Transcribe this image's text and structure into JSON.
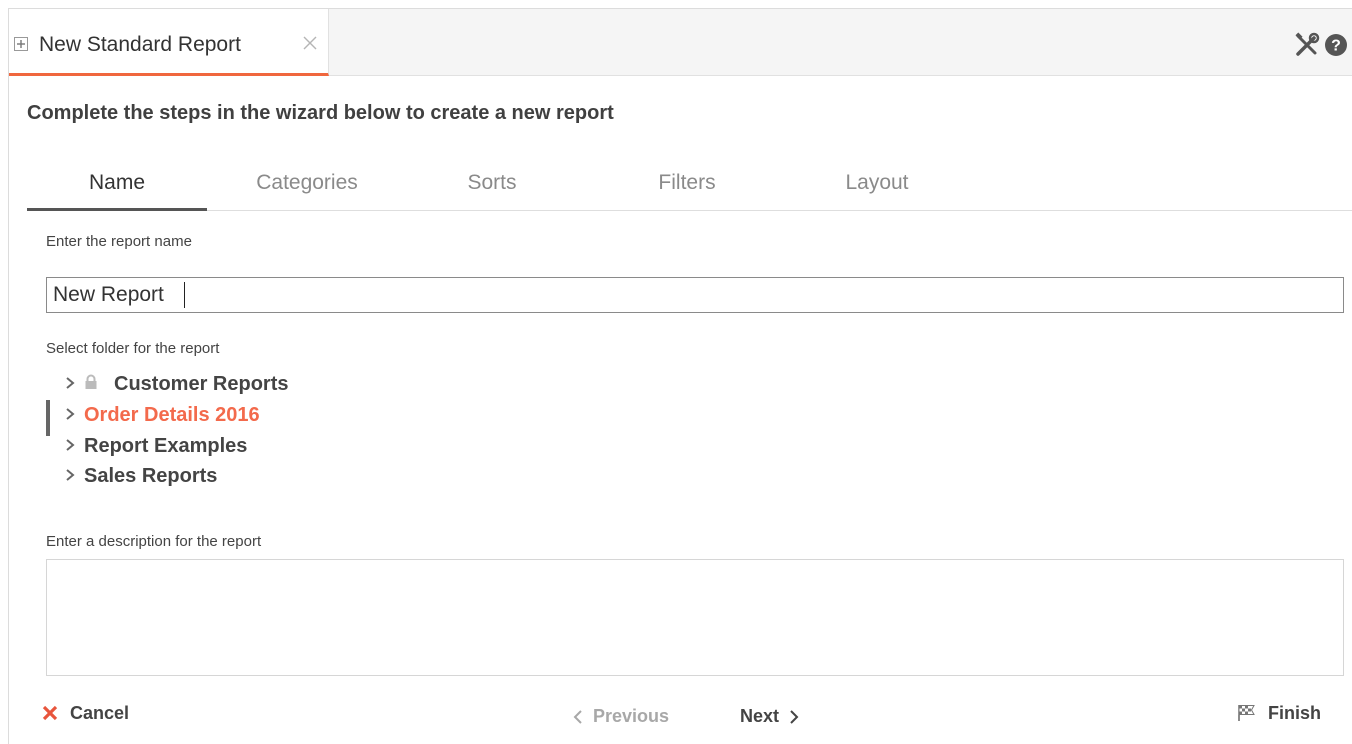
{
  "tab": {
    "title": "New Standard Report"
  },
  "heading": "Complete the steps in the wizard below to create a new report",
  "wizard_tabs": [
    {
      "label": "Name",
      "active": true
    },
    {
      "label": "Categories",
      "active": false
    },
    {
      "label": "Sorts",
      "active": false
    },
    {
      "label": "Filters",
      "active": false
    },
    {
      "label": "Layout",
      "active": false
    }
  ],
  "name_section": {
    "label": "Enter the report name",
    "value": "New Report"
  },
  "folder_section": {
    "label": "Select folder for the report",
    "folders": [
      {
        "label": "Customer Reports",
        "locked": true,
        "selected": false
      },
      {
        "label": "Order Details 2016",
        "locked": false,
        "selected": true
      },
      {
        "label": "Report Examples",
        "locked": false,
        "selected": false
      },
      {
        "label": "Sales Reports",
        "locked": false,
        "selected": false
      }
    ]
  },
  "description_section": {
    "label": "Enter a description for the report",
    "value": ""
  },
  "footer": {
    "cancel": "Cancel",
    "previous": "Previous",
    "next": "Next",
    "finish": "Finish"
  },
  "colors": {
    "accent": "#f0673e",
    "selected_text": "#f36a4c",
    "cancel_icon": "#e8553c"
  },
  "icons": [
    "expand-icon",
    "close-icon",
    "tools-icon",
    "help-icon",
    "chevron-right-icon",
    "lock-icon",
    "cancel-x-icon",
    "chevron-left-icon",
    "checkered-flag-icon"
  ]
}
